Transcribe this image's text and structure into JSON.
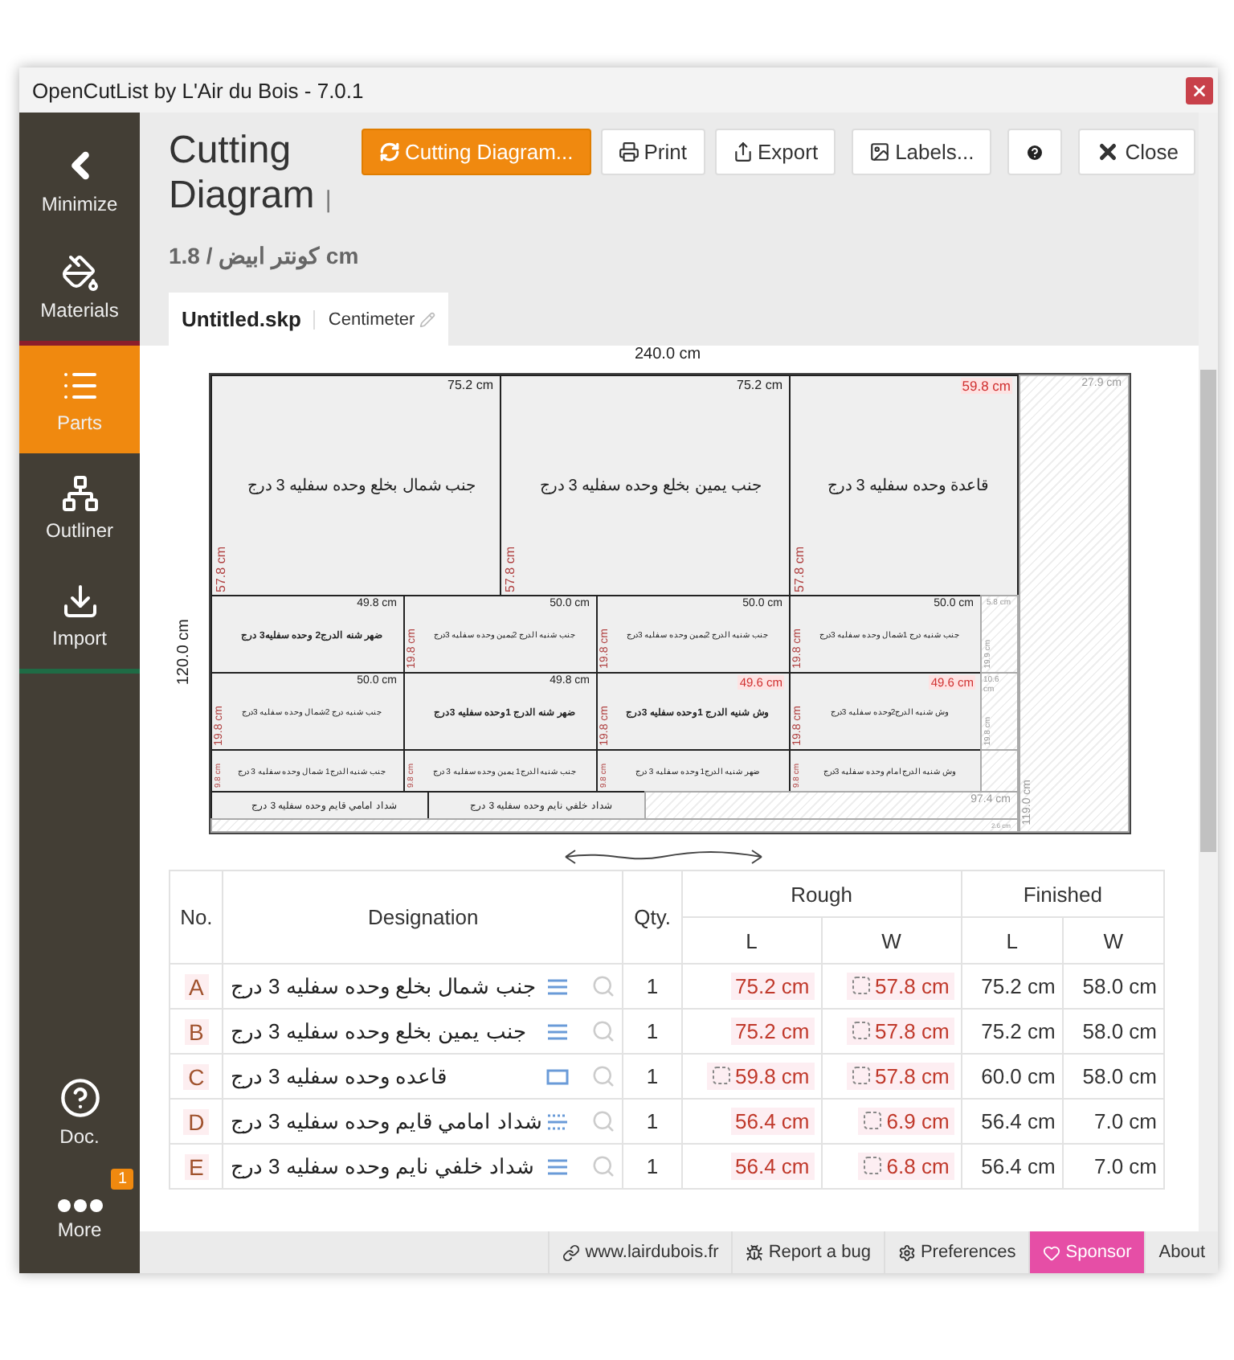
{
  "window": {
    "title": "OpenCutList by L'Air du Bois - 7.0.1"
  },
  "sidebar": {
    "items": [
      {
        "label": "Minimize",
        "kind": "minimize",
        "selected": false
      },
      {
        "label": "Materials",
        "kind": "materials",
        "selected": false
      },
      {
        "label": "Parts",
        "kind": "parts",
        "selected": true
      },
      {
        "label": "Outliner",
        "kind": "outliner",
        "selected": false
      },
      {
        "label": "Import",
        "kind": "import",
        "selected": false
      },
      {
        "label": "Doc.",
        "kind": "doc",
        "selected": false
      },
      {
        "label": "More",
        "kind": "more",
        "selected": false,
        "badge": "1"
      }
    ]
  },
  "header": {
    "title": "Cutting Diagram",
    "separator": "|",
    "subtitle": "1.8 / كونتر ابيض cm",
    "buttons": [
      {
        "label": "Cutting Diagram...",
        "kind": "refresh",
        "primary": true
      },
      {
        "label": "Print",
        "kind": "print",
        "primary": false
      },
      {
        "label": "Export",
        "kind": "export",
        "primary": false
      },
      {
        "label": "Labels...",
        "kind": "labels",
        "primary": false
      },
      {
        "kind": "help",
        "primary": false
      },
      {
        "label": "Close",
        "kind": "close",
        "primary": false
      }
    ]
  },
  "tabs": [
    {
      "label": "Untitled.skp",
      "kind": "file"
    },
    {
      "label": "Centimeter",
      "kind": "unit"
    }
  ],
  "diagram": {
    "board_length": "240.0 cm",
    "board_width": "120.0 cm",
    "pieces": [
      {
        "kind": "part",
        "length": "75.2 cm",
        "width": "57.8 cm",
        "length_trimmed": false
      },
      {
        "kind": "part",
        "length": "75.2 cm",
        "width": "57.8 cm",
        "length_trimmed": false
      },
      {
        "kind": "part",
        "length": "59.8 cm",
        "width": "57.8 cm",
        "length_trimmed": true
      },
      {
        "kind": "waste",
        "length": "27.9 cm",
        "width": "119.0 cm"
      },
      {
        "kind": "part",
        "length": "49.8 cm",
        "length_trimmed": false
      },
      {
        "kind": "part",
        "length": "50.0 cm",
        "width": "19.8 cm",
        "length_trimmed": false
      },
      {
        "kind": "part",
        "length": "50.0 cm",
        "width": "19.8 cm",
        "length_trimmed": false
      },
      {
        "kind": "part",
        "length": "50.0 cm",
        "width": "19.8 cm",
        "length_trimmed": false
      },
      {
        "kind": "waste",
        "length": "5.8 cm",
        "width": "19.9 cm"
      },
      {
        "kind": "part",
        "length": "50.0 cm",
        "width": "19.8 cm",
        "length_trimmed": false
      },
      {
        "kind": "part",
        "length": "49.8 cm",
        "length_trimmed": false
      },
      {
        "kind": "part",
        "length": "49.6 cm",
        "width": "19.8 cm",
        "length_trimmed": true
      },
      {
        "kind": "part",
        "length": "49.6 cm",
        "width": "19.8 cm",
        "length_trimmed": true
      },
      {
        "kind": "waste",
        "length": "10.6 cm",
        "width": "19.8 cm"
      },
      {
        "kind": "part",
        "width": "9.8 cm"
      },
      {
        "kind": "part",
        "width": "9.8 cm"
      },
      {
        "kind": "part",
        "width": "9.8 cm"
      },
      {
        "kind": "part",
        "width": "9.8 cm"
      },
      {
        "kind": "waste"
      },
      {
        "kind": "part"
      },
      {
        "kind": "part"
      },
      {
        "kind": "waste",
        "length": "97.4 cm"
      },
      {
        "kind": "waste",
        "length": "2.6 cm"
      }
    ],
    "labels": [
      {
        "text": "قاعدة وحده سفليه 3 درج",
        "bold": false
      },
      {
        "text": "جنب يمين بخلع وحده سفليه 3 درج",
        "bold": false
      },
      {
        "text": "جنب شمال بخلع وحده سفليه 3 درج",
        "bold": false
      },
      {
        "text": "جنب شنيه درج 1شمال وحده سفليه 3درج",
        "bold": false
      },
      {
        "text": "جنب شنيه الدرج 2يمين وحده سفليه 3درج",
        "bold": false
      },
      {
        "text": "جنب شنيه الدرج 2يمين وحده سفليه 3درج",
        "bold": false
      },
      {
        "text": "ضهر شنه الدرج2 وحده سفليه3 درج",
        "bold": true
      },
      {
        "text": "وش شنيه الدرج2وحده سفليه 3درج",
        "bold": false
      },
      {
        "text": "وش شنيه الدرج 1وحده سفليه 3درج",
        "bold": true
      },
      {
        "text": "ضهر شنه الدرج 1وحده سفليه 3درج",
        "bold": true
      },
      {
        "text": "جنب شنيه درج 2شمال وحده سفليه 3درج",
        "bold": false
      },
      {
        "text": "وش شنيه الدرج امام وحده سفليه 3درج",
        "bold": false
      },
      {
        "text": "ضهر شنيه الدرج1 وحده سفليه 3 درج",
        "bold": false
      },
      {
        "text": "جنب شنيه الدرج1 يمين وحده سفليه 3 درج",
        "bold": false
      },
      {
        "text": "جنب شنيه الدرج1 شمال وحده سفليه 3 درج",
        "bold": false
      },
      {
        "text": "شداد خلفي نايم وحده سفليه 3 درج",
        "bold": false
      },
      {
        "text": "شداد امامي قايم وحده سفليه 3 درج",
        "bold": false
      }
    ]
  },
  "table": {
    "columns": [
      "No.",
      "Designation",
      "Qty."
    ],
    "groups": [
      {
        "label": "Rough",
        "columns": [
          "L",
          "W"
        ]
      },
      {
        "label": "Finished",
        "columns": [
          "L",
          "W"
        ]
      }
    ],
    "rows": [
      {
        "id": "A",
        "name": "جنب شمال بخلع وحده سفليه 3 درج",
        "kind": "double",
        "qty": "1",
        "rough_l": {
          "value": "75.2 cm",
          "trimmed": false
        },
        "rough_w": {
          "value": "57.8 cm",
          "trimmed": true
        },
        "finished_l": "75.2 cm",
        "finished_w": "58.0 cm"
      },
      {
        "id": "B",
        "name": "جنب يمين بخلع وحده سفليه 3 درج",
        "kind": "double",
        "qty": "1",
        "rough_l": {
          "value": "75.2 cm",
          "trimmed": false
        },
        "rough_w": {
          "value": "57.8 cm",
          "trimmed": true
        },
        "finished_l": "75.2 cm",
        "finished_w": "58.0 cm"
      },
      {
        "id": "C",
        "name": "قاعده وحده سفليه 3 درج",
        "kind": "box",
        "qty": "1",
        "rough_l": {
          "value": "59.8 cm",
          "trimmed": true
        },
        "rough_w": {
          "value": "57.8 cm",
          "trimmed": true
        },
        "finished_l": "60.0 cm",
        "finished_w": "58.0 cm"
      },
      {
        "id": "D",
        "name": "شداد امامي قايم وحده سفليه 3 درج",
        "kind": "dotted",
        "qty": "1",
        "rough_l": {
          "value": "56.4 cm",
          "trimmed": false
        },
        "rough_w": {
          "value": "6.9 cm",
          "trimmed": true
        },
        "finished_l": "56.4 cm",
        "finished_w": "7.0 cm"
      },
      {
        "id": "E",
        "name": "شداد خلفي نايم وحده سفليه 3 درج",
        "kind": "double",
        "qty": "1",
        "rough_l": {
          "value": "56.4 cm",
          "trimmed": false
        },
        "rough_w": {
          "value": "6.8 cm",
          "trimmed": true
        },
        "finished_l": "56.4 cm",
        "finished_w": "7.0 cm"
      }
    ]
  },
  "footer": {
    "links": [
      {
        "label": "www.lairdubois.fr",
        "kind": "link"
      },
      {
        "label": "Report a bug",
        "kind": "bug"
      },
      {
        "label": "Preferences",
        "kind": "gear"
      },
      {
        "label": "Sponsor",
        "kind": "sponsor"
      },
      {
        "label": "About",
        "kind": "plain"
      }
    ]
  }
}
